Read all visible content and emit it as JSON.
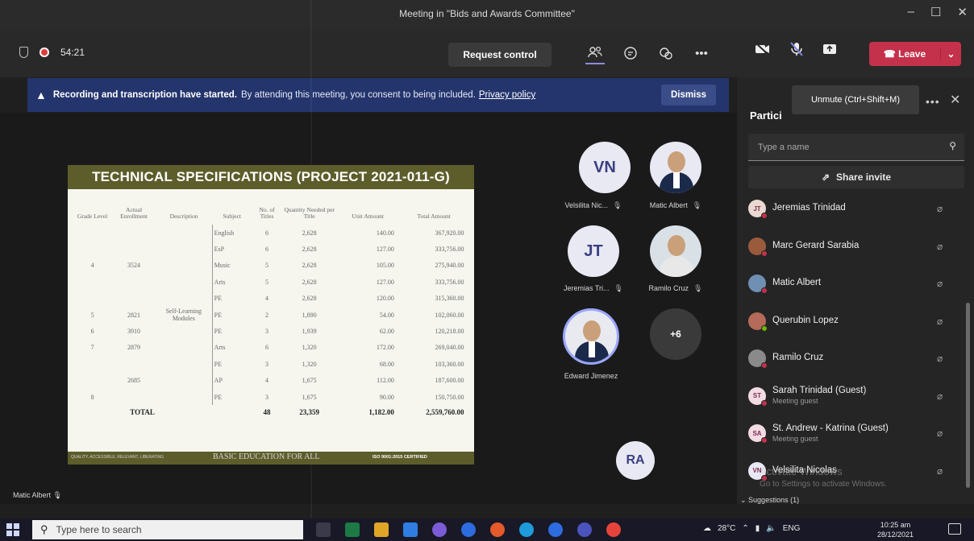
{
  "window": {
    "title": "Meeting in \"Bids and Awards Committee\"",
    "controls": [
      "–",
      "☐",
      "✕"
    ]
  },
  "toolbar": {
    "timer": "54:21",
    "request_control": "Request control",
    "leave": "Leave",
    "icons": [
      "shield-icon",
      "record-icon",
      "people-icon",
      "chat-icon",
      "reactions-icon",
      "more-icon",
      "camera-off-icon",
      "mic-off-icon",
      "share-icon"
    ]
  },
  "banner": {
    "bold": "Recording and transcription have started.",
    "text": "By attending this meeting, you consent to being included.",
    "link": "Privacy policy",
    "dismiss": "Dismiss"
  },
  "slide": {
    "title": "TECHNICAL SPECIFICATIONS (PROJECT 2021-011-G)",
    "headers": [
      "Grade Level",
      "Actual Enrollment",
      "Description",
      "Subject",
      "No. of Titles",
      "Quantity Needed per Title",
      "Unit Amount",
      "Total Amount"
    ],
    "rows": [
      {
        "grade": "",
        "enrollment": "",
        "description": "",
        "subject": "English",
        "titles": "6",
        "qty": "2,628",
        "unit": "140.00",
        "total": "367,920.00"
      },
      {
        "grade": "",
        "enrollment": "",
        "description": "",
        "subject": "EsP",
        "titles": "6",
        "qty": "2,628",
        "unit": "127.00",
        "total": "333,756.00"
      },
      {
        "grade": "4",
        "enrollment": "3524",
        "description": "",
        "subject": "Music",
        "titles": "5",
        "qty": "2,628",
        "unit": "105.00",
        "total": "275,940.00"
      },
      {
        "grade": "",
        "enrollment": "",
        "description": "",
        "subject": "Arts",
        "titles": "5",
        "qty": "2,628",
        "unit": "127.00",
        "total": "333,756.00"
      },
      {
        "grade": "",
        "enrollment": "",
        "description": "",
        "subject": "PE",
        "titles": "4",
        "qty": "2,628",
        "unit": "120.00",
        "total": "315,360.00"
      },
      {
        "grade": "5",
        "enrollment": "2821",
        "description": "Self-Learning Modules",
        "subject": "PE",
        "titles": "2",
        "qty": "1,890",
        "unit": "54.00",
        "total": "102,060.00"
      },
      {
        "grade": "6",
        "enrollment": "3910",
        "description": "",
        "subject": "PE",
        "titles": "3",
        "qty": "1,939",
        "unit": "62.00",
        "total": "120,218.00"
      },
      {
        "grade": "7",
        "enrollment": "2879",
        "description": "",
        "subject": "Arts",
        "titles": "6",
        "qty": "1,320",
        "unit": "172.00",
        "total": "269,040.00"
      },
      {
        "grade": "",
        "enrollment": "",
        "description": "",
        "subject": "PE",
        "titles": "3",
        "qty": "1,320",
        "unit": "68.00",
        "total": "103,360.00"
      },
      {
        "grade": "",
        "enrollment": "2685",
        "description": "",
        "subject": "AP",
        "titles": "4",
        "qty": "1,675",
        "unit": "112.00",
        "total": "187,600.00"
      },
      {
        "grade": "8",
        "enrollment": "",
        "description": "",
        "subject": "PE",
        "titles": "3",
        "qty": "1,675",
        "unit": "90.00",
        "total": "150,750.00"
      }
    ],
    "total": {
      "label": "TOTAL",
      "titles": "48",
      "qty": "23,359",
      "unit": "1,182.00",
      "total": "2,559,760.00"
    },
    "footer_small": "QUALITY, ACCESSIBLE, RELEVANT, LIBERATING",
    "footer": "BASIC EDUCATION FOR ALL",
    "iso": "ISO 9001:2015 CERTIFIED"
  },
  "tiles": [
    {
      "initials": "VN",
      "name": "Velsilita Nic..."
    },
    {
      "initials": "",
      "name": "Matic Albert"
    },
    {
      "initials": "JT",
      "name": "Jeremias Tri..."
    },
    {
      "initials": "",
      "name": "Ramilo Cruz"
    },
    {
      "initials": "",
      "name": "Edward Jimenez"
    },
    {
      "initials": "+6",
      "name": ""
    },
    {
      "initials": "RA",
      "name": ""
    }
  ],
  "speaker_label": "Matic Albert",
  "panel": {
    "title": "Partici",
    "tooltip": "Unmute (Ctrl+Shift+M)",
    "search_placeholder": "Type a name",
    "share_invite": "Share invite",
    "participants": [
      {
        "initials": "JT",
        "name": "Jeremias Trinidad",
        "sub": "",
        "avatar_color": "#e9d9d0",
        "status_color": "#c4314b"
      },
      {
        "initials": "",
        "name": "Marc Gerard Sarabia",
        "sub": "",
        "avatar_color": "#9a5b3d",
        "status_color": "#c4314b"
      },
      {
        "initials": "",
        "name": "Matic Albert",
        "sub": "",
        "avatar_color": "#6f8fb3",
        "status_color": "#c4314b"
      },
      {
        "initials": "",
        "name": "Querubin Lopez",
        "sub": "",
        "avatar_color": "#b56a5a",
        "status_color": "#6bb700"
      },
      {
        "initials": "",
        "name": "Ramilo Cruz",
        "sub": "",
        "avatar_color": "#8a8a8a",
        "status_color": "#c4314b"
      },
      {
        "initials": "ST",
        "name": "Sarah Trinidad (Guest)",
        "sub": "Meeting guest",
        "avatar_color": "#f3dbe3",
        "status_color": "#c4314b"
      },
      {
        "initials": "SA",
        "name": "St. Andrew - Katrina (Guest)",
        "sub": "Meeting guest",
        "avatar_color": "#f3dbe3",
        "status_color": "#c4314b"
      },
      {
        "initials": "VN",
        "name": "Velsilita Nicolas",
        "sub": "",
        "avatar_color": "#e9e9f4",
        "status_color": "#c4314b"
      }
    ],
    "suggestions": "Suggestions (1)"
  },
  "watermark": {
    "line1": "Activate Windows",
    "line2": "Go to Settings to activate Windows."
  },
  "taskbar": {
    "search_placeholder": "Type here to search",
    "weather": "28°C",
    "language": "ENG",
    "time": "10:25 am",
    "date": "28/12/2021",
    "app_colors": [
      "#3a3a4a",
      "#1d7a45",
      "#e0a526",
      "#2f7de1",
      "#7b5cd6",
      "#2d6cdf",
      "#e35b2a",
      "#1e9bdb",
      "#2d6cdf",
      "#4b53bc",
      "#e8433a"
    ]
  }
}
